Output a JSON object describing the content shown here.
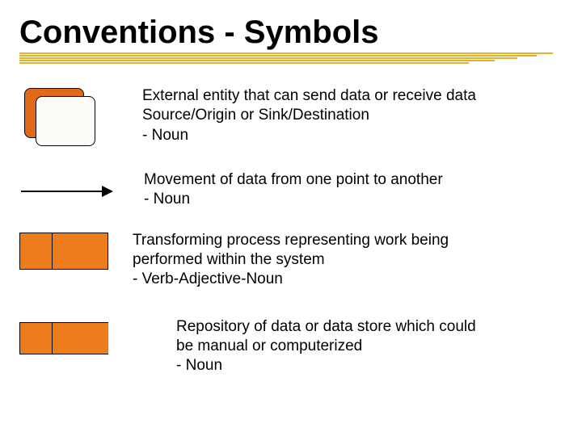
{
  "title": "Conventions - Symbols",
  "colors": {
    "orange": "#ef7c1a",
    "dark_orange": "#e06a1a",
    "mustard": "#e2b22a"
  },
  "rows": [
    {
      "symbol": "external-entity",
      "lines": [
        "External entity that can send data or receive data",
        "Source/Origin or Sink/Destination",
        "- Noun"
      ]
    },
    {
      "symbol": "data-flow-arrow",
      "lines": [
        "Movement of data from one point to another",
        "- Noun"
      ]
    },
    {
      "symbol": "process",
      "lines": [
        "Transforming process representing work being",
        "performed within the system",
        "- Verb-Adjective-Noun"
      ]
    },
    {
      "symbol": "data-store",
      "lines": [
        "Repository of data or data store which could",
        "be manual or computerized",
        "- Noun"
      ]
    }
  ]
}
